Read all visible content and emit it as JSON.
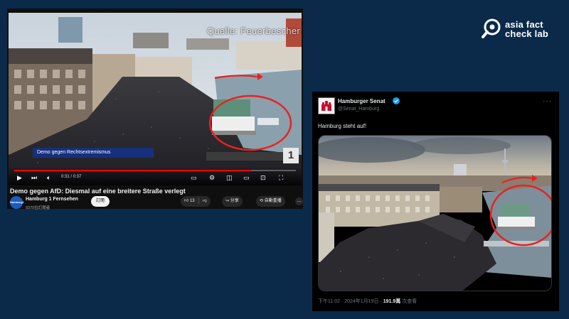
{
  "brand": {
    "line1": "asia fact",
    "line2": "check lab",
    "icon": "magnifier-icon"
  },
  "youtube": {
    "watermark": "Quelle: Feuerbescher",
    "lower_third": "Demo gegen Rechtsextremismus",
    "channel_bug": "1",
    "time": "0:31 / 0:37",
    "progress": 0.84,
    "title": "Demo gegen AfD: Diesmal auf eine breitere Straße verlegt",
    "channel": {
      "name": "Hamburg 1 Fernsehen",
      "avatar_text": "Hamburg1",
      "subscribers": "9370位訂閱者"
    },
    "subscribe_label": "訂閱",
    "like_count": "13",
    "share_label": "分享",
    "clip_label": "自動重播",
    "more_label": "…",
    "controls": [
      "play-icon",
      "next-icon",
      "volume-icon",
      "subtitles-icon",
      "settings-icon",
      "miniplayer-icon",
      "theater-icon",
      "cast-icon",
      "fullscreen-icon"
    ]
  },
  "tweet": {
    "display_name": "Hamburger Senat",
    "handle": "@Senat_Hamburg",
    "more_label": "···",
    "text": "Hamburg steht auf!",
    "meta_time": "下午11:02 · 2024年1月19日 · ",
    "views_count": "191.9萬",
    "views_label": " 次查看"
  },
  "colors": {
    "background": "#0b2a4a",
    "annotation": "#e8231f",
    "youtube_bg": "#0f0f0f",
    "tweet_bg": "#000000",
    "verified": "#1d9bf0"
  }
}
